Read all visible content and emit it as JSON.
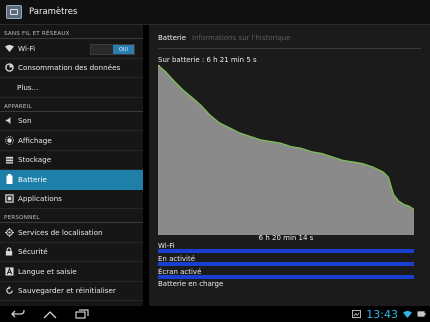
{
  "app": {
    "title": "Paramètres",
    "icon": "settings-app-icon"
  },
  "sidebar": {
    "sections": [
      {
        "header": "SANS FIL ET RÉSEAUX",
        "items": [
          {
            "label": "Wi-Fi",
            "icon": "wifi-icon",
            "toggle": "OUI"
          },
          {
            "label": "Consommation des données",
            "icon": "data-usage-icon"
          },
          {
            "label": "Plus...",
            "icon": ""
          }
        ]
      },
      {
        "header": "APPAREIL",
        "items": [
          {
            "label": "Son",
            "icon": "sound-icon"
          },
          {
            "label": "Affichage",
            "icon": "display-icon"
          },
          {
            "label": "Stockage",
            "icon": "storage-icon"
          },
          {
            "label": "Batterie",
            "icon": "battery-icon",
            "selected": true
          },
          {
            "label": "Applications",
            "icon": "apps-icon"
          }
        ]
      },
      {
        "header": "PERSONNEL",
        "items": [
          {
            "label": "Services de localisation",
            "icon": "location-icon"
          },
          {
            "label": "Sécurité",
            "icon": "lock-icon"
          },
          {
            "label": "Langue et saisie",
            "icon": "language-icon"
          },
          {
            "label": "Sauvegarder et réinitialiser",
            "icon": "backup-icon"
          }
        ]
      }
    ]
  },
  "battery": {
    "tabs": {
      "active": "Batterie",
      "inactive": "Informations sur l'historique"
    },
    "on_battery": "Sur batterie : 6 h 21 min 5 s",
    "x_label": "6 h 20 min 14 s",
    "signals": [
      {
        "label": "Wi-Fi"
      },
      {
        "label": "En activité"
      },
      {
        "label": "Écran activé"
      }
    ],
    "charging_label": "Batterie en charge",
    "colors": {
      "line": "#7cc450",
      "fill": "#8a8a8a",
      "signal": "#1a3fd0",
      "accent": "#33b5e5"
    }
  },
  "chart_data": {
    "type": "area",
    "title": "",
    "xlabel": "6 h 20 min 14 s",
    "ylabel": "",
    "ylim": [
      0,
      100
    ],
    "x": [
      0,
      3,
      6,
      10,
      14,
      17,
      20,
      24,
      28,
      32,
      36,
      40,
      44,
      48,
      52,
      56,
      58,
      60,
      64,
      68,
      72,
      76,
      80,
      84,
      88,
      90,
      92,
      94,
      96,
      98,
      100
    ],
    "values": [
      100,
      96,
      91,
      85,
      80,
      76,
      71,
      66,
      63,
      60,
      58,
      56,
      55,
      54,
      52,
      51,
      50,
      49,
      48,
      46,
      44,
      43,
      42,
      40,
      37,
      34,
      24,
      20,
      18,
      17,
      15
    ]
  },
  "status_bar": {
    "time": "13:43"
  }
}
